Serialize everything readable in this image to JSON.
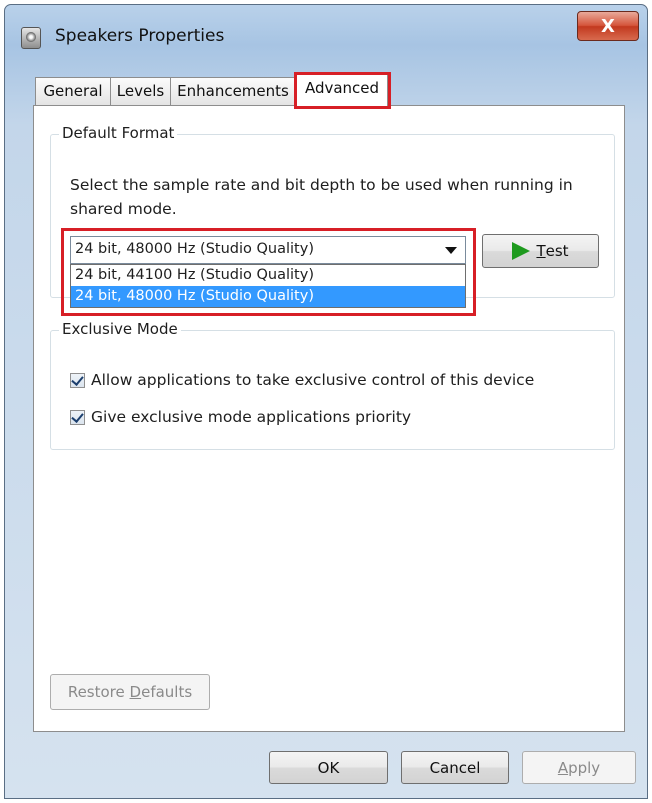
{
  "window": {
    "title": "Speakers Properties",
    "close_glyph": "X"
  },
  "tabs": [
    {
      "label": "General"
    },
    {
      "label": "Levels"
    },
    {
      "label": "Enhancements"
    },
    {
      "label": "Advanced"
    }
  ],
  "default_format": {
    "legend": "Default Format",
    "description": "Select the sample rate and bit depth to be used when running in shared mode.",
    "selected_value": "24 bit, 48000 Hz (Studio Quality)",
    "options": [
      "24 bit, 44100 Hz (Studio Quality)",
      "24 bit, 48000 Hz (Studio Quality)"
    ],
    "test_button": {
      "mnemonic": "T",
      "rest": "est"
    }
  },
  "exclusive_mode": {
    "legend": "Exclusive Mode",
    "allow_exclusive_label": "Allow applications to take exclusive control of this device",
    "priority_label": "Give exclusive mode applications priority"
  },
  "restore_defaults": {
    "before": "Restore ",
    "mnemonic": "D",
    "after": "efaults"
  },
  "footer": {
    "ok_label": "OK",
    "cancel_label": "Cancel",
    "apply_mnemonic": "A",
    "apply_rest": "pply"
  },
  "colors": {
    "highlight": "#d71f26",
    "selection": "#3399ff",
    "close_button": "#c2391f",
    "play_icon": "#1e9a1e"
  },
  "icons": [
    "app-speaker-icon",
    "close-icon",
    "dropdown-arrow-icon",
    "play-icon",
    "checkmark-icon"
  ]
}
